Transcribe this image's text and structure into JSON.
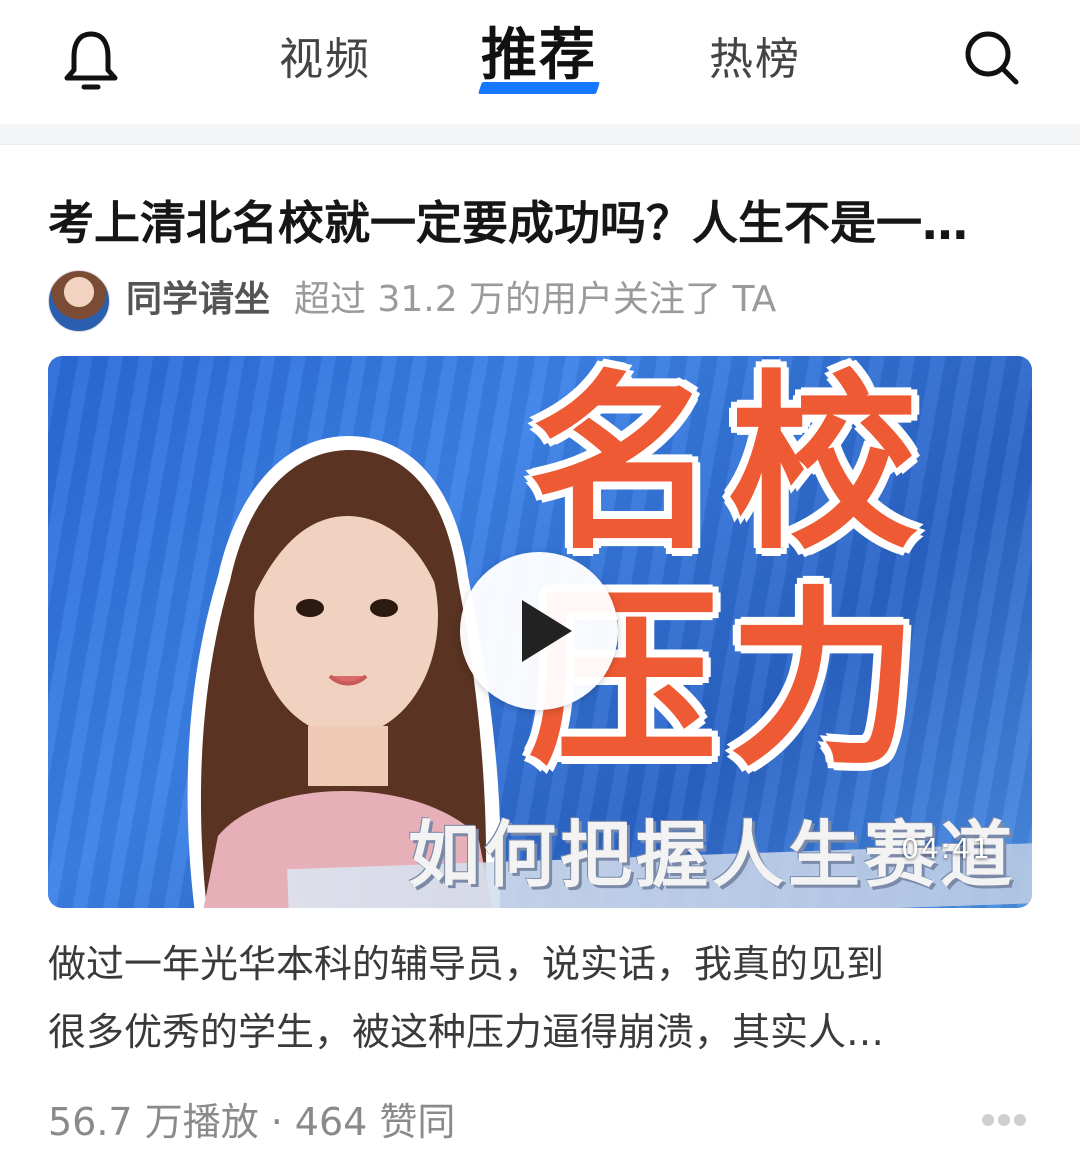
{
  "nav": {
    "tabs": [
      {
        "label": "视频",
        "active": false
      },
      {
        "label": "推荐",
        "active": true
      },
      {
        "label": "热榜",
        "active": false
      }
    ],
    "accent_color": "#1677ff",
    "left_icon": "bell-icon",
    "right_icon": "search-icon"
  },
  "card": {
    "title": "考上清北名校就一定要成功吗？人生不是一…",
    "author": {
      "name": "同学请坐",
      "meta": "超过 31.2 万的用户关注了 TA"
    },
    "thumbnail": {
      "overlay_line1": "名校",
      "overlay_line2": "压力",
      "overlay_subtitle": "如何把握人生赛道",
      "duration": "04:41",
      "highlight_color": "#ee5a33"
    },
    "description": {
      "line1": "做过一年光华本科的辅导员，说实话，我真的见到",
      "line2": "很多优秀的学生，被这种压力逼得崩溃，其实人…"
    },
    "stats": {
      "plays": "56.7 万播放",
      "separator": "·",
      "likes": "464 赞同"
    },
    "more_icon": "more-dots-icon"
  }
}
